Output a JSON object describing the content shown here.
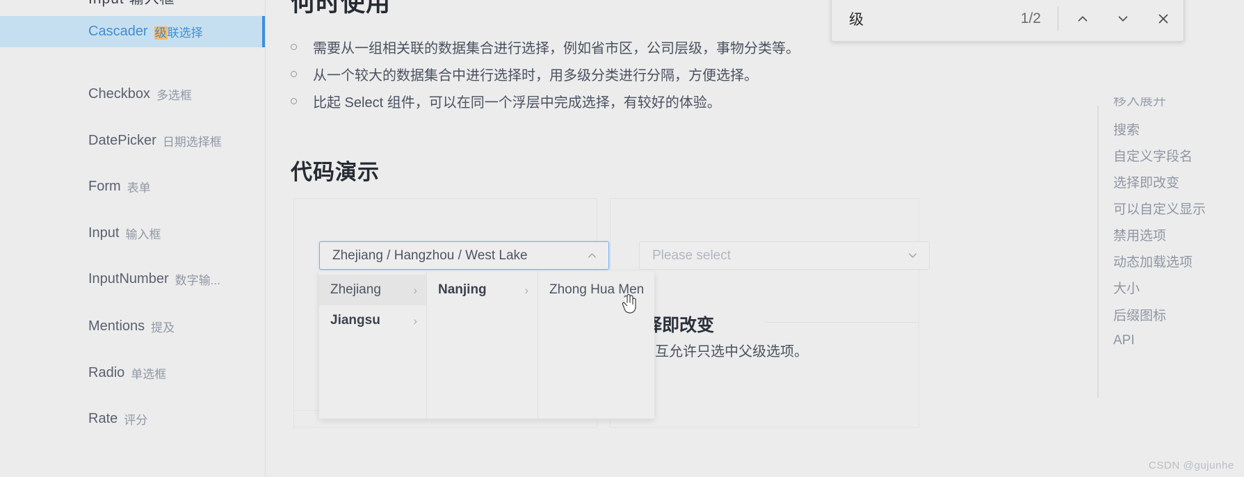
{
  "find_bar": {
    "query": "级",
    "count": "1/2",
    "prev_icon": "chevron-up-icon",
    "next_icon": "chevron-down-icon",
    "close_icon": "close-icon"
  },
  "sidebar": {
    "clipped_top_label": "Input 输入框",
    "items": [
      {
        "name": "Cascader",
        "cn": "联选择",
        "highlight": "级",
        "active": true
      },
      {
        "name": "Checkbox",
        "cn": "多选框",
        "active": false
      },
      {
        "name": "DatePicker",
        "cn": "日期选择框",
        "active": false
      },
      {
        "name": "Form",
        "cn": "表单",
        "active": false
      },
      {
        "name": "Input",
        "cn": "输入框",
        "active": false
      },
      {
        "name": "InputNumber",
        "cn": "数字输...",
        "active": false
      },
      {
        "name": "Mentions",
        "cn": "提及",
        "active": false
      },
      {
        "name": "Radio",
        "cn": "单选框",
        "active": false
      },
      {
        "name": "Rate",
        "cn": "评分",
        "active": false
      }
    ]
  },
  "main": {
    "page_heading": "何时使用",
    "bullets": [
      "需要从一组相关联的数据集合进行选择，例如省市区，公司层级，事物分类等。",
      "从一个较大的数据集合中进行选择时，用多级分类进行分隔，方便选择。",
      "比起 Select 组件，可以在同一个浮层中完成选择，有较好的体验。"
    ],
    "demo_heading": "代码演示",
    "sub_heading": "选择即改变",
    "sub_desc": "种交互允许只选中父级选项。",
    "cascader": {
      "value": "Zhejiang / Hangzhou / West Lake",
      "chevron_icon": "chevron-up-icon",
      "columns": [
        {
          "items": [
            {
              "label": "Zhejiang",
              "arrow": "›",
              "hovered": true,
              "bold": false
            },
            {
              "label": "Jiangsu",
              "arrow": "›",
              "hovered": false,
              "bold": true
            }
          ]
        },
        {
          "items": [
            {
              "label": "Nanjing",
              "arrow": "›",
              "hovered": false,
              "bold": true
            }
          ]
        },
        {
          "items": [
            {
              "label": "Zhong Hua Men",
              "arrow": "",
              "hovered": false,
              "bold": false
            }
          ]
        }
      ]
    },
    "select": {
      "placeholder": "Please select",
      "chevron_icon": "chevron-down-icon"
    },
    "toolbar": {
      "copy_icon": "copy-icon",
      "code_icon": "code-brackets-icon"
    }
  },
  "right_nav": {
    "clipped_top_label": "移入展开",
    "items": [
      "搜索",
      "自定义字段名",
      "选择即改变",
      "可以自定义显示",
      "禁用选项",
      "动态加载选项",
      "大小",
      "后缀图标",
      "API"
    ]
  },
  "watermark": "CSDN @gujunhe",
  "colors": {
    "accent": "#3e8fd8",
    "active_bg": "#c6dff0",
    "highlight": "#f7b96a",
    "page_bg": "#ececec"
  }
}
